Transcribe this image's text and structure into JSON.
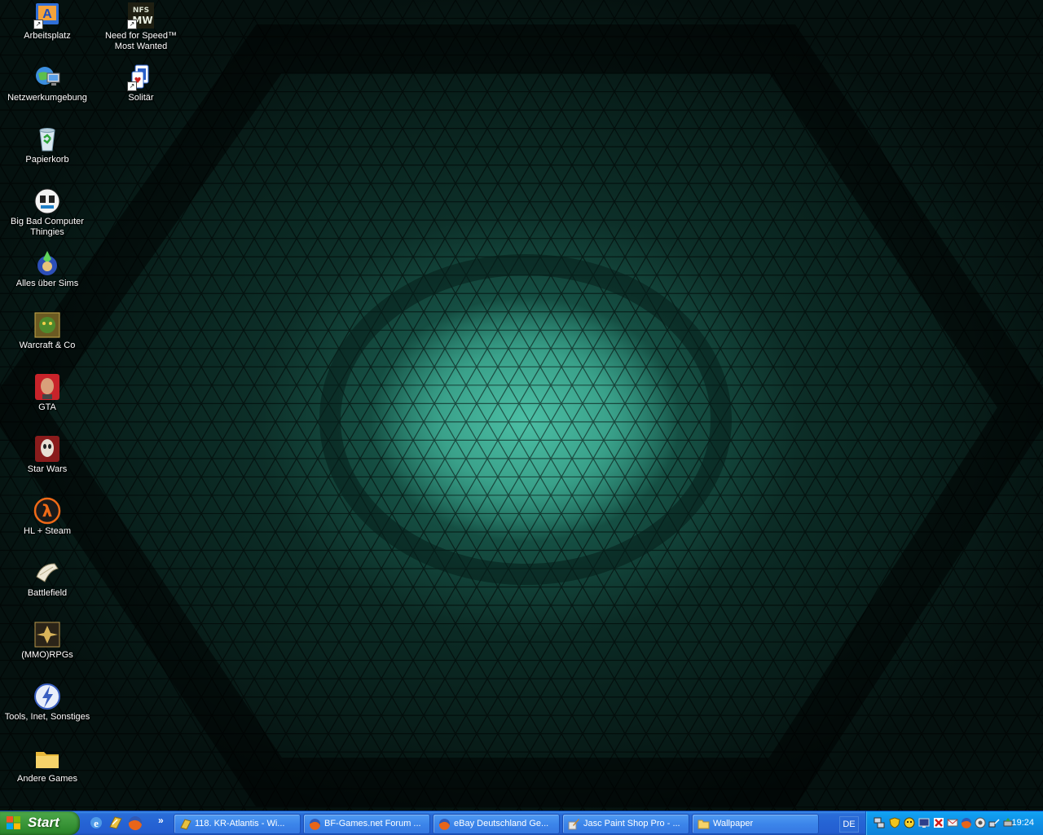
{
  "desktop": {
    "icons": [
      {
        "name": "arbeitsplatz-icon",
        "label": "Arbeitsplatz"
      },
      {
        "name": "nfs-icon",
        "label": "Need for Speed™ Most Wanted"
      },
      {
        "name": "netzwerk-icon",
        "label": "Netzwerkumgebung"
      },
      {
        "name": "solitaer-icon",
        "label": "Solitär"
      },
      {
        "name": "papierkorb-icon",
        "label": "Papierkorb"
      },
      {
        "name": "big-bad-icon",
        "label": "Big Bad Computer Thingies"
      },
      {
        "name": "sims-icon",
        "label": "Alles über Sims"
      },
      {
        "name": "warcraft-icon",
        "label": "Warcraft & Co"
      },
      {
        "name": "gta-icon",
        "label": "GTA"
      },
      {
        "name": "star-wars-icon",
        "label": "Star Wars"
      },
      {
        "name": "half-life-icon",
        "label": "HL + Steam"
      },
      {
        "name": "battlefield-icon",
        "label": "Battlefield"
      },
      {
        "name": "rpg-icon",
        "label": "(MMO)RPGs"
      },
      {
        "name": "tools-icon",
        "label": "Tools, Inet, Sonstiges"
      },
      {
        "name": "folder-icon",
        "label": "Andere Games"
      }
    ]
  },
  "taskbar": {
    "start_label": "Start",
    "quicklaunch": [
      "ie-icon",
      "winamp-icon",
      "firefox-icon"
    ],
    "chevron": "»",
    "tasks": [
      {
        "label": "118. KR-Atlantis - Wi...",
        "icon": "winamp-icon"
      },
      {
        "label": "BF-Games.net Forum ...",
        "icon": "firefox-icon"
      },
      {
        "label": "eBay Deutschland Ge...",
        "icon": "firefox-icon"
      },
      {
        "label": "Jasc Paint Shop Pro - ...",
        "icon": "paintshop-icon"
      },
      {
        "label": "Wallpaper",
        "icon": "folder-icon"
      }
    ],
    "language": "DE",
    "clock": "19:24",
    "tray_icons": [
      "network-icon",
      "shield-icon",
      "msn-icon",
      "monitor-icon",
      "security-alert-icon",
      "mail-icon",
      "firefox-icon",
      "steam-icon",
      "network-connection-icon",
      "safely-remove-icon"
    ]
  },
  "colors": {
    "wallpaper_accent": "#3aa18a",
    "taskbar_blue": "#245ed0",
    "start_green": "#3f9a3d",
    "tray_blue": "#0e90e6"
  }
}
